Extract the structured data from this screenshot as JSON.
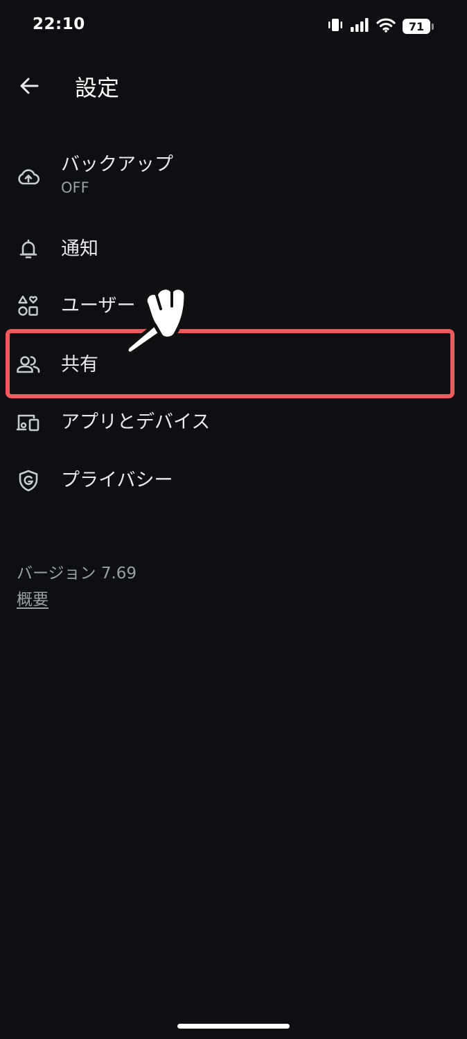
{
  "status_bar": {
    "time": "22:10",
    "battery_level": "71",
    "icons": [
      "vibrate-icon",
      "signal-icon",
      "wifi-icon",
      "battery-icon"
    ]
  },
  "header": {
    "title": "設定",
    "back_icon": "arrow-left-icon"
  },
  "menu": {
    "items": [
      {
        "label": "バックアップ",
        "sublabel": "OFF",
        "icon": "cloud-upload-icon"
      },
      {
        "label": "通知",
        "icon": "bell-icon"
      },
      {
        "label": "ユーザー",
        "icon": "categories-icon"
      },
      {
        "label": "共有",
        "icon": "people-icon"
      },
      {
        "label": "アプリとデバイス",
        "icon": "devices-icon"
      },
      {
        "label": "プライバシー",
        "icon": "shield-g-icon"
      }
    ]
  },
  "footer": {
    "version": "バージョン 7.69",
    "about": "概要"
  },
  "colors": {
    "background": "#0e0f12",
    "highlight": "#ef5a5f",
    "text_primary": "#e8eaed",
    "text_secondary": "#9aa0a6"
  }
}
